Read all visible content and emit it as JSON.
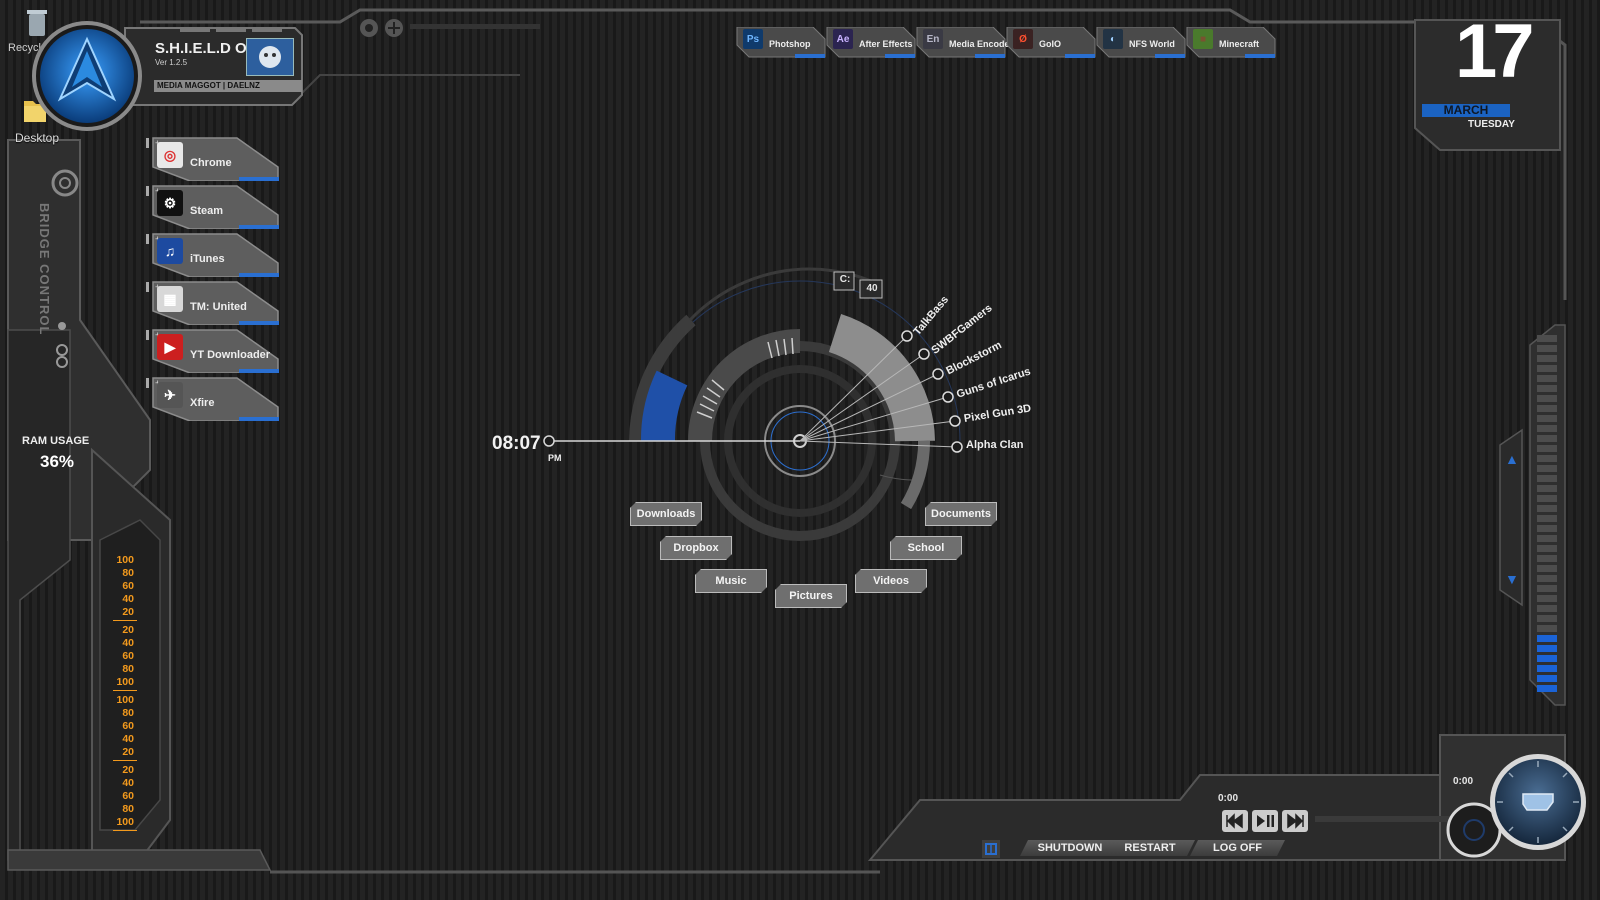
{
  "desktop": {
    "recycle_label": "Recycl",
    "desktop_label": "Desktop"
  },
  "header": {
    "os_title": "S.H.I.E.L.D OS",
    "version": "Ver 1.2.5",
    "credit": "MEDIA MAGGOT  |  DAELNZ"
  },
  "sidebar": {
    "bridge_label": "BRIDGE CONTROL",
    "ram_title": "RAM USAGE",
    "ram_value": "36%",
    "scale_groups": [
      [
        "100",
        "80",
        "60",
        "40",
        "20"
      ],
      [
        "20",
        "40",
        "60",
        "80",
        "100"
      ],
      [
        "100",
        "80",
        "60",
        "40",
        "20"
      ],
      [
        "20",
        "40",
        "60",
        "80",
        "100"
      ]
    ]
  },
  "dock": {
    "items": [
      {
        "label": "Chrome",
        "icon": "chrome-icon",
        "color": "#e8e8e8"
      },
      {
        "label": "Steam",
        "icon": "steam-icon",
        "color": "#111111"
      },
      {
        "label": "iTunes",
        "icon": "itunes-icon",
        "color": "#1d4aa0"
      },
      {
        "label": "TM: United",
        "icon": "trackmania-icon",
        "color": "#d8d8d8"
      },
      {
        "label": "YT Downloader",
        "icon": "youtube-icon",
        "color": "#cc1f1f"
      },
      {
        "label": "Xfire",
        "icon": "xfire-icon",
        "color": "#555555"
      }
    ]
  },
  "top_launcher": {
    "items": [
      {
        "label": "Photshop",
        "icon_text": "Ps",
        "bg": "#0f3a6b",
        "fg": "#6fb6ff"
      },
      {
        "label": "After Effects",
        "icon_text": "Ae",
        "bg": "#2b2450",
        "fg": "#c9b3ff"
      },
      {
        "label": "Media Encoder",
        "icon_text": "En",
        "bg": "#3a3a44",
        "fg": "#b7b7c8"
      },
      {
        "label": "GoIO",
        "icon_text": "Ø",
        "bg": "#3a2222",
        "fg": "#ff5030"
      },
      {
        "label": "NFS World",
        "icon_text": "◐",
        "bg": "#223344",
        "fg": "#9fd0ff"
      },
      {
        "label": "Minecraft",
        "icon_text": "■",
        "bg": "#4a7a2c",
        "fg": "#7a5230"
      }
    ]
  },
  "date": {
    "day": "17",
    "month": "MARCH",
    "weekday": "TUESDAY"
  },
  "radial": {
    "time": "08:07",
    "ampm": "PM",
    "drive_letter": "C:",
    "drive_value": "40",
    "games": [
      "TalkBass",
      "SWBFGamers",
      "Blockstorm",
      "Guns of Icarus",
      "Pixel Gun 3D",
      "Alpha Clan"
    ]
  },
  "folders": {
    "items": [
      "Downloads",
      "Dropbox",
      "Music",
      "Pictures",
      "Videos",
      "School",
      "Documents"
    ]
  },
  "media": {
    "elapsed": "0:00",
    "remaining": "0:00",
    "progress": 0,
    "volume_level": 0.45
  },
  "power": {
    "shutdown": "SHUTDOWN",
    "restart": "RESTART",
    "logoff": "LOG OFF"
  },
  "colors": {
    "accent_blue": "#1b63c2",
    "scale_orange": "#f39a1d",
    "panel_gray": "#4a4a4a"
  }
}
